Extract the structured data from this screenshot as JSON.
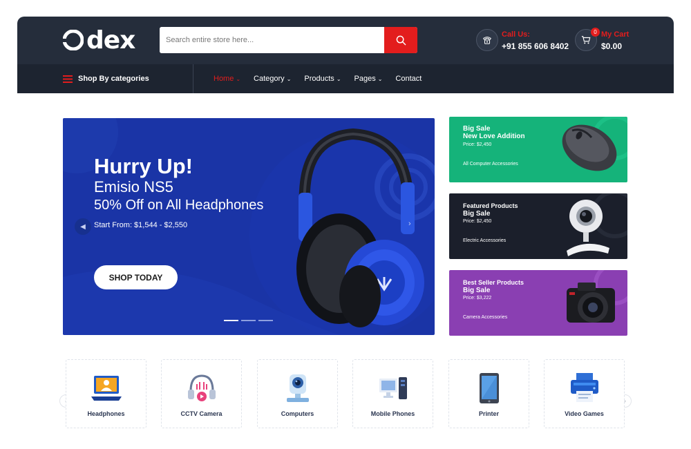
{
  "header": {
    "logo_text": "dex",
    "search_placeholder": "Search entire store here...",
    "call_label": "Call Us:",
    "call_number": "+91 855 606 8402",
    "cart_label": "My Cart",
    "cart_total": "$0.00",
    "cart_count": "0"
  },
  "nav": {
    "categories_label": "Shop By categories",
    "items": [
      {
        "label": "Home"
      },
      {
        "label": "Category"
      },
      {
        "label": "Products"
      },
      {
        "label": "Pages"
      },
      {
        "label": "Contact"
      }
    ]
  },
  "hero": {
    "title": "Hurry Up!",
    "subtitle": "Emisio NS5",
    "offer": "50% Off on All Headphones",
    "price_range": "Start From: $1,544 - $2,550",
    "button": "SHOP TODAY",
    "slide_count": 3,
    "active_slide": 1
  },
  "banners": [
    {
      "tag": "Big Sale",
      "title": "New Love Addition",
      "price": "Price: $2,450",
      "subtitle": "All Computer Accessories",
      "color": "#15b37a"
    },
    {
      "tag": "Featured Products",
      "title": "Big Sale",
      "price": "Price: $2,450",
      "subtitle": "Electric Accessories",
      "color": "#1b1f2b"
    },
    {
      "tag": "Best Seller Products",
      "title": "Big Sale",
      "price": "Price: $3,222",
      "subtitle": "Camera Accessories",
      "color": "#8a3fb2"
    }
  ],
  "categories": [
    {
      "label": "Headphones",
      "icon": "laptop-user-icon"
    },
    {
      "label": "CCTV Camera",
      "icon": "headphones-play-icon"
    },
    {
      "label": "Computers",
      "icon": "webcam-icon"
    },
    {
      "label": "Mobile Phones",
      "icon": "desktop-computer-icon"
    },
    {
      "label": "Printer",
      "icon": "tablet-icon"
    },
    {
      "label": "Video Games",
      "icon": "printer-icon"
    }
  ],
  "colors": {
    "accent": "#e31d1d",
    "header_bg": "#252d3b",
    "nav_bg": "#1d2430",
    "hero_bg": "#1a34a6"
  }
}
